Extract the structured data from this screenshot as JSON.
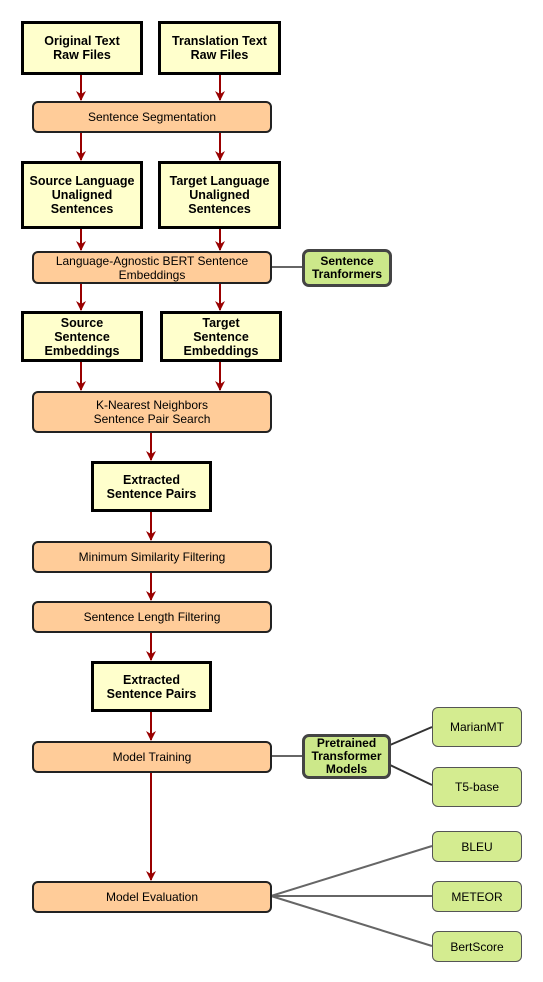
{
  "nodes": {
    "original": "Original Text Raw Files",
    "translation": "Translation Text Raw Files",
    "segmentation": "Sentence Segmentation",
    "source_unaligned": "Source Language Unaligned Sentences",
    "target_unaligned": "Target Language Unaligned Sentences",
    "labse": "Language-Agnostic BERT Sentence Embeddings",
    "sentence_transformers": "Sentence Tranformers",
    "source_emb": "Source Sentence Embeddings",
    "target_emb": "Target Sentence Embeddings",
    "knn": "K-Nearest Neighbors Sentence Pair Search",
    "extracted1": "Extracted Sentence Pairs",
    "min_sim": "Minimum Similarity Filtering",
    "length": "Sentence Length Filtering",
    "extracted2": "Extracted Sentence Pairs",
    "training": "Model Training",
    "pretrained": "Pretrained Transformer Models",
    "marian": "MarianMT",
    "t5": "T5-base",
    "evaluation": "Model Evaluation",
    "bleu": "BLEU",
    "meteor": "METEOR",
    "bertscore": "BertScore"
  },
  "colors": {
    "input": "#ffffcc",
    "process": "#ffcc99",
    "model": "#cce88a",
    "arrow": "#990000"
  }
}
